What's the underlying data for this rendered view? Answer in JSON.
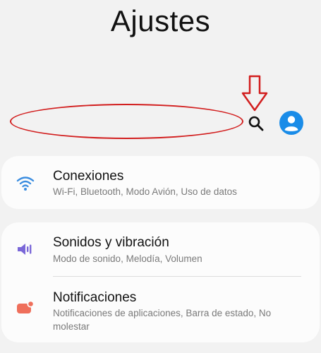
{
  "header": {
    "title": "Ajustes"
  },
  "toolbar": {
    "search_icon": "search-icon",
    "profile_icon": "profile-icon"
  },
  "annotation": {
    "color": "#d21e1e"
  },
  "settings": {
    "group1": [
      {
        "title": "Conexiones",
        "subtitle": "Wi-Fi, Bluetooth, Modo Avión, Uso de datos",
        "icon": "wifi-icon",
        "icon_color": "#3b8de0"
      }
    ],
    "group2": [
      {
        "title": "Sonidos y vibración",
        "subtitle": "Modo de sonido, Melodía, Volumen",
        "icon": "volume-icon",
        "icon_color": "#7a67d8"
      },
      {
        "title": "Notificaciones",
        "subtitle": "Notificaciones de aplicaciones, Barra de estado, No molestar",
        "icon": "notification-icon",
        "icon_color": "#ef6f5b"
      }
    ]
  },
  "colors": {
    "accent": "#1a8ce8",
    "background": "#f2f2f2",
    "card": "#fcfcfc"
  }
}
